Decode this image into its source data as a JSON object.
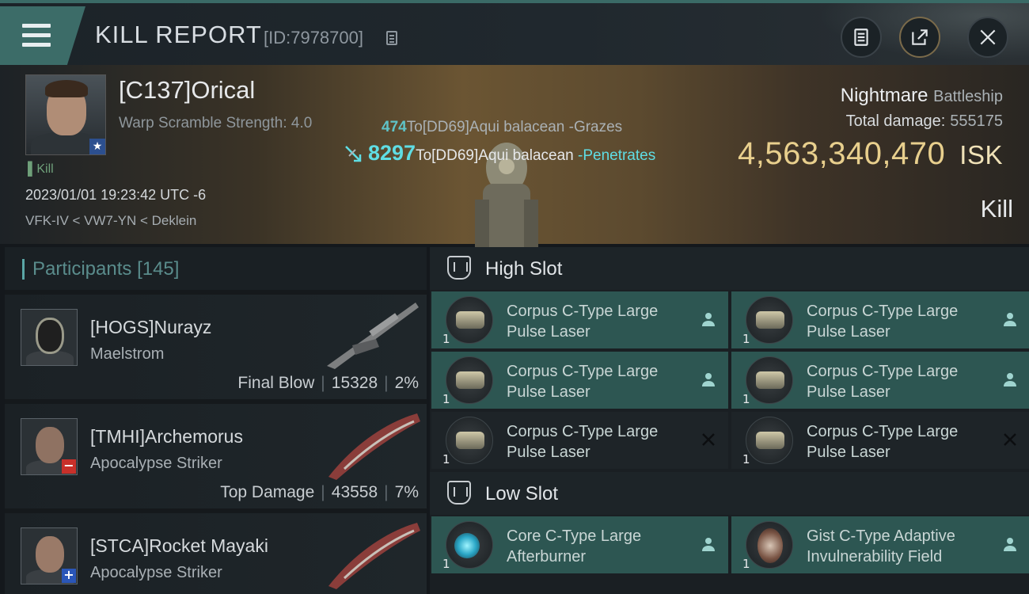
{
  "header": {
    "title": "KILL REPORT",
    "report_id": "[ID:7978700]"
  },
  "victim": {
    "name": "[C137]Orical",
    "warp_scramble": "Warp Scramble Strength: 4.0",
    "kill_tag": "Kill",
    "time": "2023/01/01 19:23:42 UTC -6",
    "location": "VFK-IV < VW7-YN < Deklein"
  },
  "damage_events": [
    {
      "amount": "474",
      "text": "To[DD69]Aqui balacean -Grazes"
    },
    {
      "amount": "8297",
      "text": "To[DD69]Aqui balacean",
      "result": "-Penetrates"
    }
  ],
  "ship": {
    "name": "Nightmare",
    "class": "Battleship",
    "total_damage_label": "Total damage:",
    "total_damage": "555175",
    "isk_value": "4,563,340,470",
    "isk_unit": "ISK",
    "outcome": "Kill"
  },
  "participants": {
    "title": "Participants",
    "count": "[145]",
    "rows": [
      {
        "name": "[HOGS]Nurayz",
        "ship": "Maelstrom",
        "role": "Final Blow",
        "damage": "15328",
        "percent": "2%"
      },
      {
        "name": "[TMHI]Archemorus",
        "ship": "Apocalypse Striker",
        "role": "Top Damage",
        "damage": "43558",
        "percent": "7%"
      },
      {
        "name": "[STCA]Rocket Mayaki",
        "ship": "Apocalypse Striker"
      }
    ]
  },
  "slots": {
    "high": {
      "title": "High Slot",
      "items": [
        {
          "name": "Corpus C-Type Large Pulse Laser",
          "qty": "1",
          "state": "person-icon"
        },
        {
          "name": "Corpus C-Type Large Pulse Laser",
          "qty": "1",
          "state": "person-icon"
        },
        {
          "name": "Corpus C-Type Large Pulse Laser",
          "qty": "1",
          "state": "person-icon"
        },
        {
          "name": "Corpus C-Type Large Pulse Laser",
          "qty": "1",
          "state": "person-icon"
        },
        {
          "name": "Corpus C-Type Large Pulse Laser",
          "qty": "1",
          "state": "destroyed-x-icon"
        },
        {
          "name": "Corpus C-Type Large Pulse Laser",
          "qty": "1",
          "state": "destroyed-x-icon"
        }
      ]
    },
    "low": {
      "title": "Low Slot",
      "items": [
        {
          "name": "Core C-Type Large Afterburner",
          "qty": "1",
          "state": "person-icon"
        },
        {
          "name": "Gist C-Type Adaptive Invulnerability Field",
          "qty": "1",
          "state": "person-icon"
        }
      ]
    }
  },
  "colors": {
    "accent_teal": "#5fdde4",
    "isk_gold": "#e8cf8d",
    "dropped_item_bg": "#2d5652",
    "destroyed_item_bg": "#1e2428"
  }
}
